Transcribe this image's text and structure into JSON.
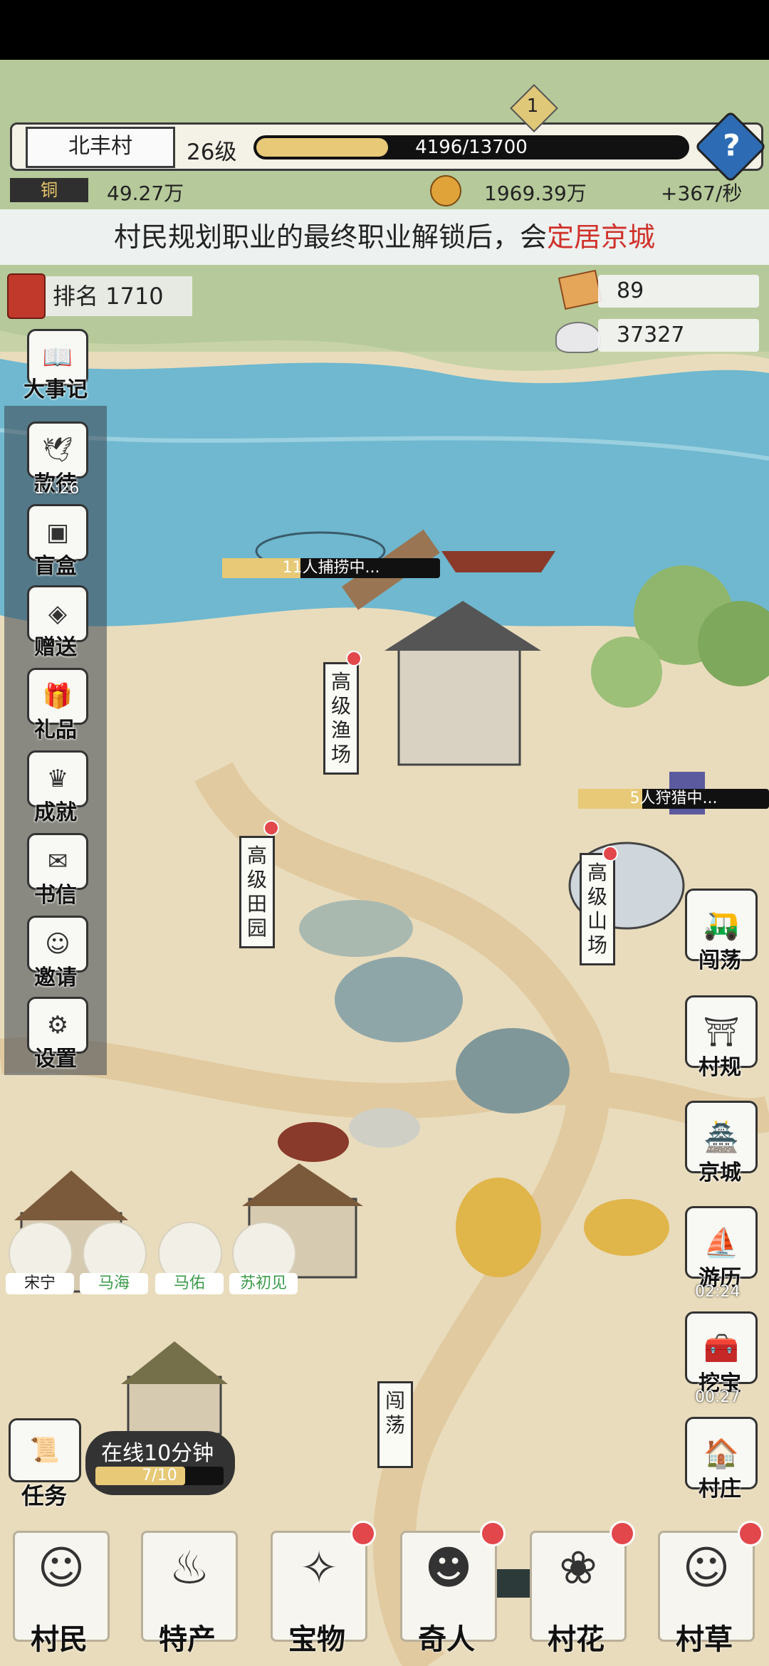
{
  "header": {
    "village_name": "北丰村",
    "level": "26级",
    "xp_text": "4196/13700",
    "xp_fraction": 0.306,
    "help_icon": "?",
    "badge_number": "1",
    "resource_left": "49.27万",
    "resource_mid": "1969.39万",
    "resource_rate": "+367/秒"
  },
  "banner": {
    "text_main": "村民规划职业的最终职业解锁后，会",
    "text_highlight": "定居京城"
  },
  "stats": {
    "rank": "排名 1710",
    "resource_a": "89",
    "resource_b": "37327"
  },
  "left_menu": {
    "top_item": "大事记",
    "items": [
      {
        "label": "款待",
        "timer": "17:26",
        "icon": "scroll-icon"
      },
      {
        "label": "盲盒",
        "timer": "",
        "icon": "box-icon"
      },
      {
        "label": "赠送",
        "timer": "",
        "icon": "bag-icon"
      },
      {
        "label": "礼品",
        "timer": "",
        "icon": "gift-icon"
      },
      {
        "label": "成就",
        "timer": "",
        "icon": "trophy-icon"
      },
      {
        "label": "书信",
        "timer": "",
        "icon": "letter-icon"
      },
      {
        "label": "邀请",
        "timer": "",
        "icon": "person-icon"
      },
      {
        "label": "设置",
        "timer": "",
        "icon": "gear-icon"
      }
    ]
  },
  "map": {
    "fish_progress": "11人捕捞中...",
    "hunt_progress": "5人狩猎中...",
    "sign_fish": "高级渔场",
    "sign_farm": "高级田园",
    "sign_mountain": "高级山场",
    "sign_road": "闯荡"
  },
  "characters": [
    "宋宁",
    "马海",
    "马佑",
    "苏初见"
  ],
  "right_menu": [
    {
      "label": "闯荡",
      "timer": ""
    },
    {
      "label": "村规",
      "timer": ""
    },
    {
      "label": "京城",
      "timer": ""
    },
    {
      "label": "游历",
      "timer": "02:24"
    },
    {
      "label": "挖宝",
      "timer": "00:27"
    },
    {
      "label": "村庄",
      "timer": ""
    }
  ],
  "task": {
    "label": "任务",
    "online_text": "在线10分钟",
    "progress_text": "7/10",
    "progress_fraction": 0.7
  },
  "bottom_tabs": [
    {
      "label": "村民",
      "dot": false
    },
    {
      "label": "特产",
      "dot": false
    },
    {
      "label": "宝物",
      "dot": true
    },
    {
      "label": "奇人",
      "dot": true
    },
    {
      "label": "村花",
      "dot": true
    },
    {
      "label": "村草",
      "dot": true
    }
  ],
  "colors": {
    "accent_red": "#d0312b",
    "water": "#6fb8cf",
    "sand": "#e9d9b4",
    "grass": "#a9c48b"
  }
}
